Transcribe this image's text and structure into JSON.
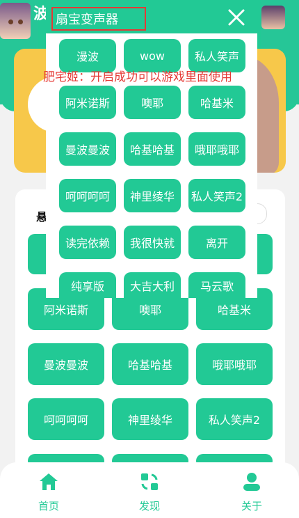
{
  "app": {
    "title_partial": "波"
  },
  "card": {
    "section_label": "悬"
  },
  "main_grid": [
    "阿米诺斯",
    "噢耶",
    "哈基米",
    "曼波曼波",
    "哈基哈基",
    "哦耶哦耶",
    "呵呵呵呵",
    "神里绫华",
    "私人笑声2"
  ],
  "popup": {
    "title": "扇宝变声器",
    "notice": "肥宅姬：开启成功可以游戏里面使用",
    "buttons": [
      "漫波",
      "wow",
      "私人笑声",
      "阿米诺斯",
      "噢耶",
      "哈基米",
      "曼波曼波",
      "哈基哈基",
      "哦耶哦耶",
      "呵呵呵呵",
      "神里绫华",
      "私人笑声2",
      "读完依赖",
      "我很快就",
      "离开",
      "纯享版",
      "大吉大利",
      "马云歌"
    ]
  },
  "nav": {
    "home": "首页",
    "discover": "发现",
    "about": "关于"
  },
  "colors": {
    "accent": "#22c995",
    "highlight": "#e53935"
  }
}
